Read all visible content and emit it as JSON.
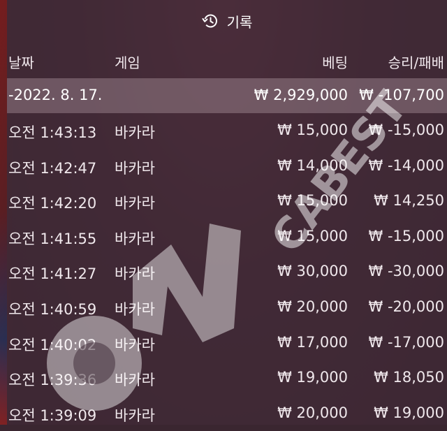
{
  "title": {
    "label": "기록",
    "icon": "history-icon"
  },
  "columns": {
    "date": "날짜",
    "game": "게임",
    "bet": "베팅",
    "win_loss": "승리/패배"
  },
  "summary": {
    "date": "-2022. 8. 17.",
    "bet": "₩ 2,929,000",
    "win_loss": "₩ -107,700"
  },
  "rows": [
    {
      "time": "오전 1:43:13",
      "game": "바카라",
      "bet": "₩ 15,000",
      "win_loss": "₩ -15,000"
    },
    {
      "time": "오전 1:42:47",
      "game": "바카라",
      "bet": "₩ 14,000",
      "win_loss": "₩ -14,000"
    },
    {
      "time": "오전 1:42:20",
      "game": "바카라",
      "bet": "₩ 15,000",
      "win_loss": "₩ 14,250"
    },
    {
      "time": "오전 1:41:55",
      "game": "바카라",
      "bet": "₩ 15,000",
      "win_loss": "₩ -15,000"
    },
    {
      "time": "오전 1:41:27",
      "game": "바카라",
      "bet": "₩ 30,000",
      "win_loss": "₩ -30,000"
    },
    {
      "time": "오전 1:40:59",
      "game": "바카라",
      "bet": "₩ 20,000",
      "win_loss": "₩ -20,000"
    },
    {
      "time": "오전 1:40:02",
      "game": "바카라",
      "bet": "₩ 17,000",
      "win_loss": "₩ -17,000"
    },
    {
      "time": "오전 1:39:36",
      "game": "바카라",
      "bet": "₩ 19,000",
      "win_loss": "₩ 18,050"
    },
    {
      "time": "오전 1:39:09",
      "game": "바카라",
      "bet": "₩ 20,000",
      "win_loss": "₩ 19,000"
    }
  ],
  "watermark": {
    "text": "ONCABEST"
  }
}
